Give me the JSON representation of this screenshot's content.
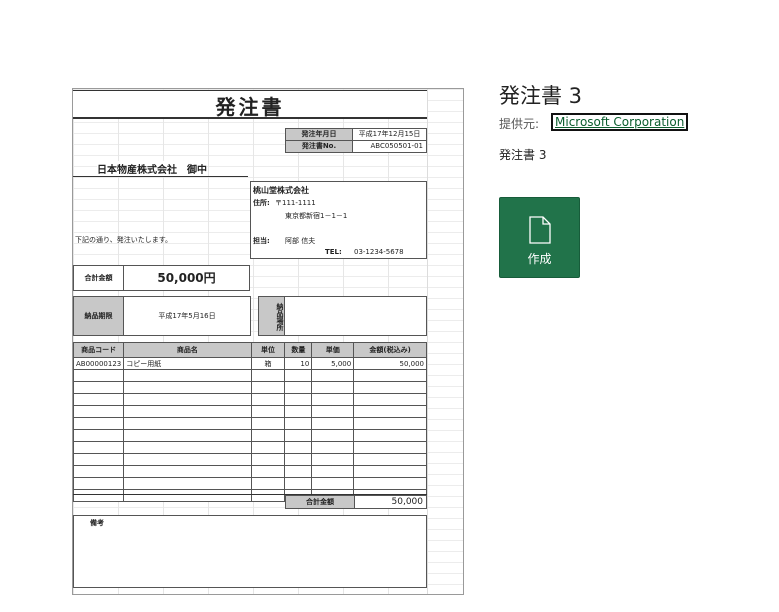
{
  "template": {
    "title": "発注書 3",
    "provider_label": "提供元:",
    "provider_name": "Microsoft Corporation",
    "subtitle": "発注書 3"
  },
  "create_button": {
    "label": "作成",
    "icon": "new-document-icon"
  },
  "colors": {
    "button_bg": "#21734a",
    "link": "#0b5d2e"
  },
  "preview_doc": {
    "title": "発注書",
    "order_date_label": "発注年月日",
    "order_date": "平成17年12月15日",
    "order_no_label": "発注書No.",
    "order_no": "ABC050501-01",
    "recipient": "日本物産株式会社　御中",
    "company": "桃山堂株式会社",
    "address_label": "住所:",
    "postal": "〒111-1111",
    "address": "東京都新宿1－1－1",
    "contact_label": "担当:",
    "contact": "阿部 信夫",
    "tel_label": "TEL:",
    "tel": "03-1234-5678",
    "intro": "下記の通り、発注いたします。",
    "total_label": "合計金額",
    "total": "50,000円",
    "deadline_label": "納品期限",
    "deadline": "平成17年5月16日",
    "place_label": "納品場所",
    "headers": [
      "商品コード",
      "商品名",
      "単位",
      "数量",
      "単価",
      "金額(税込み)"
    ],
    "rows": [
      [
        "AB00000123",
        "コピー用紙",
        "箱",
        "10",
        "5,000",
        "50,000"
      ],
      [
        "",
        "",
        "",
        "",
        "",
        ""
      ],
      [
        "",
        "",
        "",
        "",
        "",
        ""
      ],
      [
        "",
        "",
        "",
        "",
        "",
        ""
      ],
      [
        "",
        "",
        "",
        "",
        "",
        ""
      ],
      [
        "",
        "",
        "",
        "",
        "",
        ""
      ],
      [
        "",
        "",
        "",
        "",
        "",
        ""
      ],
      [
        "",
        "",
        "",
        "",
        "",
        ""
      ],
      [
        "",
        "",
        "",
        "",
        "",
        ""
      ],
      [
        "",
        "",
        "",
        "",
        "",
        ""
      ],
      [
        "",
        "",
        "",
        "",
        "",
        ""
      ],
      [
        "",
        "",
        "",
        "",
        "",
        ""
      ]
    ],
    "sum_label": "合計金額",
    "sum": "50,000",
    "notes_label": "備考"
  }
}
